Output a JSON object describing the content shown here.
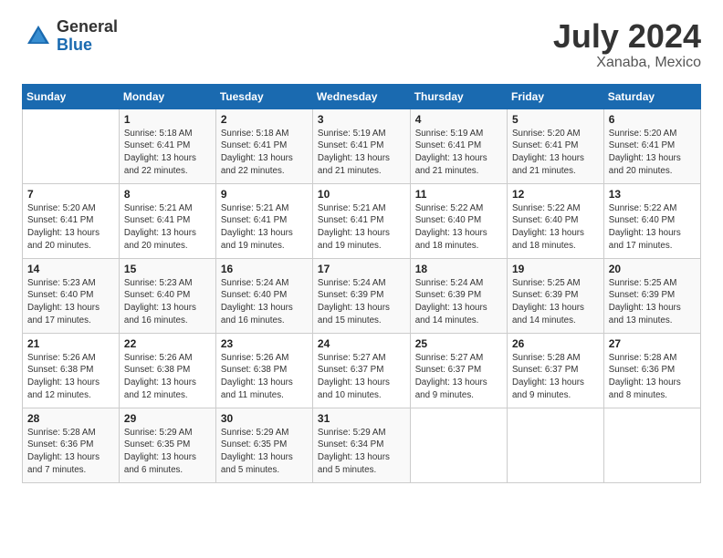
{
  "header": {
    "logo_general": "General",
    "logo_blue": "Blue",
    "month_title": "July 2024",
    "location": "Xanaba, Mexico"
  },
  "weekdays": [
    "Sunday",
    "Monday",
    "Tuesday",
    "Wednesday",
    "Thursday",
    "Friday",
    "Saturday"
  ],
  "weeks": [
    [
      {
        "day": "",
        "sunrise": "",
        "sunset": "",
        "daylight": ""
      },
      {
        "day": "1",
        "sunrise": "Sunrise: 5:18 AM",
        "sunset": "Sunset: 6:41 PM",
        "daylight": "Daylight: 13 hours and 22 minutes."
      },
      {
        "day": "2",
        "sunrise": "Sunrise: 5:18 AM",
        "sunset": "Sunset: 6:41 PM",
        "daylight": "Daylight: 13 hours and 22 minutes."
      },
      {
        "day": "3",
        "sunrise": "Sunrise: 5:19 AM",
        "sunset": "Sunset: 6:41 PM",
        "daylight": "Daylight: 13 hours and 21 minutes."
      },
      {
        "day": "4",
        "sunrise": "Sunrise: 5:19 AM",
        "sunset": "Sunset: 6:41 PM",
        "daylight": "Daylight: 13 hours and 21 minutes."
      },
      {
        "day": "5",
        "sunrise": "Sunrise: 5:20 AM",
        "sunset": "Sunset: 6:41 PM",
        "daylight": "Daylight: 13 hours and 21 minutes."
      },
      {
        "day": "6",
        "sunrise": "Sunrise: 5:20 AM",
        "sunset": "Sunset: 6:41 PM",
        "daylight": "Daylight: 13 hours and 20 minutes."
      }
    ],
    [
      {
        "day": "7",
        "sunrise": "Sunrise: 5:20 AM",
        "sunset": "Sunset: 6:41 PM",
        "daylight": "Daylight: 13 hours and 20 minutes."
      },
      {
        "day": "8",
        "sunrise": "Sunrise: 5:21 AM",
        "sunset": "Sunset: 6:41 PM",
        "daylight": "Daylight: 13 hours and 20 minutes."
      },
      {
        "day": "9",
        "sunrise": "Sunrise: 5:21 AM",
        "sunset": "Sunset: 6:41 PM",
        "daylight": "Daylight: 13 hours and 19 minutes."
      },
      {
        "day": "10",
        "sunrise": "Sunrise: 5:21 AM",
        "sunset": "Sunset: 6:41 PM",
        "daylight": "Daylight: 13 hours and 19 minutes."
      },
      {
        "day": "11",
        "sunrise": "Sunrise: 5:22 AM",
        "sunset": "Sunset: 6:40 PM",
        "daylight": "Daylight: 13 hours and 18 minutes."
      },
      {
        "day": "12",
        "sunrise": "Sunrise: 5:22 AM",
        "sunset": "Sunset: 6:40 PM",
        "daylight": "Daylight: 13 hours and 18 minutes."
      },
      {
        "day": "13",
        "sunrise": "Sunrise: 5:22 AM",
        "sunset": "Sunset: 6:40 PM",
        "daylight": "Daylight: 13 hours and 17 minutes."
      }
    ],
    [
      {
        "day": "14",
        "sunrise": "Sunrise: 5:23 AM",
        "sunset": "Sunset: 6:40 PM",
        "daylight": "Daylight: 13 hours and 17 minutes."
      },
      {
        "day": "15",
        "sunrise": "Sunrise: 5:23 AM",
        "sunset": "Sunset: 6:40 PM",
        "daylight": "Daylight: 13 hours and 16 minutes."
      },
      {
        "day": "16",
        "sunrise": "Sunrise: 5:24 AM",
        "sunset": "Sunset: 6:40 PM",
        "daylight": "Daylight: 13 hours and 16 minutes."
      },
      {
        "day": "17",
        "sunrise": "Sunrise: 5:24 AM",
        "sunset": "Sunset: 6:39 PM",
        "daylight": "Daylight: 13 hours and 15 minutes."
      },
      {
        "day": "18",
        "sunrise": "Sunrise: 5:24 AM",
        "sunset": "Sunset: 6:39 PM",
        "daylight": "Daylight: 13 hours and 14 minutes."
      },
      {
        "day": "19",
        "sunrise": "Sunrise: 5:25 AM",
        "sunset": "Sunset: 6:39 PM",
        "daylight": "Daylight: 13 hours and 14 minutes."
      },
      {
        "day": "20",
        "sunrise": "Sunrise: 5:25 AM",
        "sunset": "Sunset: 6:39 PM",
        "daylight": "Daylight: 13 hours and 13 minutes."
      }
    ],
    [
      {
        "day": "21",
        "sunrise": "Sunrise: 5:26 AM",
        "sunset": "Sunset: 6:38 PM",
        "daylight": "Daylight: 13 hours and 12 minutes."
      },
      {
        "day": "22",
        "sunrise": "Sunrise: 5:26 AM",
        "sunset": "Sunset: 6:38 PM",
        "daylight": "Daylight: 13 hours and 12 minutes."
      },
      {
        "day": "23",
        "sunrise": "Sunrise: 5:26 AM",
        "sunset": "Sunset: 6:38 PM",
        "daylight": "Daylight: 13 hours and 11 minutes."
      },
      {
        "day": "24",
        "sunrise": "Sunrise: 5:27 AM",
        "sunset": "Sunset: 6:37 PM",
        "daylight": "Daylight: 13 hours and 10 minutes."
      },
      {
        "day": "25",
        "sunrise": "Sunrise: 5:27 AM",
        "sunset": "Sunset: 6:37 PM",
        "daylight": "Daylight: 13 hours and 9 minutes."
      },
      {
        "day": "26",
        "sunrise": "Sunrise: 5:28 AM",
        "sunset": "Sunset: 6:37 PM",
        "daylight": "Daylight: 13 hours and 9 minutes."
      },
      {
        "day": "27",
        "sunrise": "Sunrise: 5:28 AM",
        "sunset": "Sunset: 6:36 PM",
        "daylight": "Daylight: 13 hours and 8 minutes."
      }
    ],
    [
      {
        "day": "28",
        "sunrise": "Sunrise: 5:28 AM",
        "sunset": "Sunset: 6:36 PM",
        "daylight": "Daylight: 13 hours and 7 minutes."
      },
      {
        "day": "29",
        "sunrise": "Sunrise: 5:29 AM",
        "sunset": "Sunset: 6:35 PM",
        "daylight": "Daylight: 13 hours and 6 minutes."
      },
      {
        "day": "30",
        "sunrise": "Sunrise: 5:29 AM",
        "sunset": "Sunset: 6:35 PM",
        "daylight": "Daylight: 13 hours and 5 minutes."
      },
      {
        "day": "31",
        "sunrise": "Sunrise: 5:29 AM",
        "sunset": "Sunset: 6:34 PM",
        "daylight": "Daylight: 13 hours and 5 minutes."
      },
      {
        "day": "",
        "sunrise": "",
        "sunset": "",
        "daylight": ""
      },
      {
        "day": "",
        "sunrise": "",
        "sunset": "",
        "daylight": ""
      },
      {
        "day": "",
        "sunrise": "",
        "sunset": "",
        "daylight": ""
      }
    ]
  ]
}
